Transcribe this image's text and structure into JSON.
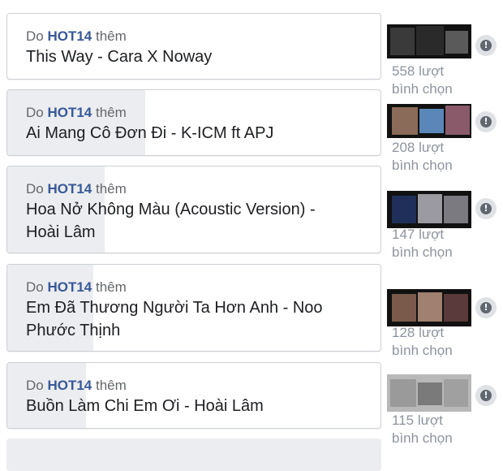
{
  "options": [
    {
      "by_prefix": "Do",
      "by_user": "HOT14",
      "by_suffix": "thêm",
      "title": "This Way - Cara X Noway",
      "votes": "558 lượt",
      "votes_label": "bình chọn",
      "fill_fraction": 0.0
    },
    {
      "by_prefix": "Do",
      "by_user": "HOT14",
      "by_suffix": "thêm",
      "title": "Ai Mang Cô Đơn Đi - K-ICM ft APJ",
      "votes": "208 lượt",
      "votes_label": "bình chọn",
      "fill_fraction": 0.37
    },
    {
      "by_prefix": "Do",
      "by_user": "HOT14",
      "by_suffix": "thêm",
      "title": "Hoa Nở Không Màu (Acoustic Version) - Hoài Lâm",
      "votes": "147 lượt",
      "votes_label": "bình chọn",
      "fill_fraction": 0.26
    },
    {
      "by_prefix": "Do",
      "by_user": "HOT14",
      "by_suffix": "thêm",
      "title": "Em Đã Thương Người Ta Hơn Anh - Noo Phước Thịnh",
      "votes": "128 lượt",
      "votes_label": "bình chọn",
      "fill_fraction": 0.23
    },
    {
      "by_prefix": "Do",
      "by_user": "HOT14",
      "by_suffix": "thêm",
      "title": "Buồn Làm Chi Em Ơi - Hoài Lâm",
      "votes": "115 lượt",
      "votes_label": "bình chọn",
      "fill_fraction": 0.21
    }
  ],
  "alert_icon": "exclamation-icon",
  "colors": {
    "user_link": "#385898",
    "fill": "#ebedf0",
    "muted": "#8d949e"
  }
}
